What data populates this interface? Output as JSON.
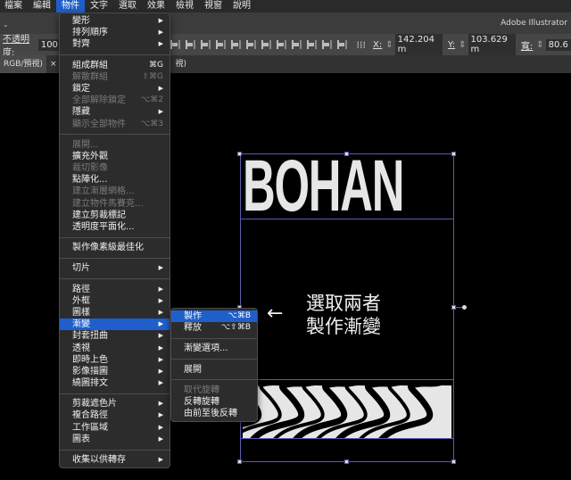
{
  "menubar": {
    "items": [
      "檔案",
      "編輯",
      "物件",
      "文字",
      "選取",
      "效果",
      "檢視",
      "視窗",
      "說明"
    ],
    "active_index": 2
  },
  "app_title": "Adobe Illustrator",
  "control": {
    "opacity_label": "不透明度:",
    "opacity_value": "100",
    "x_label": "X:",
    "x_value": "142.204 m",
    "y_label": "Y:",
    "y_value": "103.629 m",
    "w_label": "寬:",
    "w_value": "80.6"
  },
  "tabs": [
    "RGB/預視)",
    "×",
    "視)"
  ],
  "object_menu": [
    {
      "label": "變形",
      "arrow": true
    },
    {
      "label": "排列順序",
      "arrow": true
    },
    {
      "label": "對齊",
      "arrow": true
    },
    {
      "sep": true
    },
    {
      "label": "組成群組",
      "shortcut": "⌘G"
    },
    {
      "label": "解散群組",
      "shortcut": "⇧⌘G",
      "disabled": true
    },
    {
      "label": "鎖定",
      "arrow": true
    },
    {
      "label": "全部解除鎖定",
      "shortcut": "⌥⌘2",
      "disabled": true
    },
    {
      "label": "隱藏",
      "arrow": true
    },
    {
      "label": "顯示全部物件",
      "shortcut": "⌥⌘3",
      "disabled": true
    },
    {
      "sep": true
    },
    {
      "label": "展開...",
      "disabled": true
    },
    {
      "label": "擴充外觀"
    },
    {
      "label": "裁切影像",
      "disabled": true
    },
    {
      "label": "點陣化..."
    },
    {
      "label": "建立漸層網格...",
      "disabled": true
    },
    {
      "label": "建立物件馬賽克...",
      "disabled": true
    },
    {
      "label": "建立剪裁標記"
    },
    {
      "label": "透明度平面化..."
    },
    {
      "sep": true
    },
    {
      "label": "製作像素級最佳化"
    },
    {
      "sep": true
    },
    {
      "label": "切片",
      "arrow": true
    },
    {
      "sep": true
    },
    {
      "label": "路徑",
      "arrow": true
    },
    {
      "label": "外框",
      "arrow": true
    },
    {
      "label": "圖樣",
      "arrow": true
    },
    {
      "label": "漸變",
      "arrow": true,
      "highlighted": true
    },
    {
      "label": "封套扭曲",
      "arrow": true
    },
    {
      "label": "透視",
      "arrow": true
    },
    {
      "label": "即時上色",
      "arrow": true
    },
    {
      "label": "影像描圖",
      "arrow": true
    },
    {
      "label": "繞圖排文",
      "arrow": true
    },
    {
      "sep": true
    },
    {
      "label": "剪裁遮色片",
      "arrow": true
    },
    {
      "label": "複合路徑",
      "arrow": true
    },
    {
      "label": "工作區域",
      "arrow": true
    },
    {
      "label": "圖表",
      "arrow": true
    },
    {
      "sep": true
    },
    {
      "label": "收集以供轉存",
      "arrow": true
    }
  ],
  "blend_submenu": [
    {
      "label": "製作",
      "shortcut": "⌥⌘B",
      "highlighted": true
    },
    {
      "label": "釋放",
      "shortcut": "⌥⇧⌘B"
    },
    {
      "sep": true
    },
    {
      "label": "漸變選項..."
    },
    {
      "sep": true
    },
    {
      "label": "展開"
    },
    {
      "sep": true
    },
    {
      "label": "取代旋轉",
      "disabled": true
    },
    {
      "label": "反轉旋轉"
    },
    {
      "label": "由前至後反轉"
    }
  ],
  "artwork": {
    "title": "BOHAN",
    "note_line1": "選取兩者",
    "note_line2": "製作漸變",
    "arrow": "←"
  },
  "colors": {
    "accent": "#1e5fcc",
    "selection": "#5a5ab0",
    "artwork": "#e6e6e6"
  }
}
